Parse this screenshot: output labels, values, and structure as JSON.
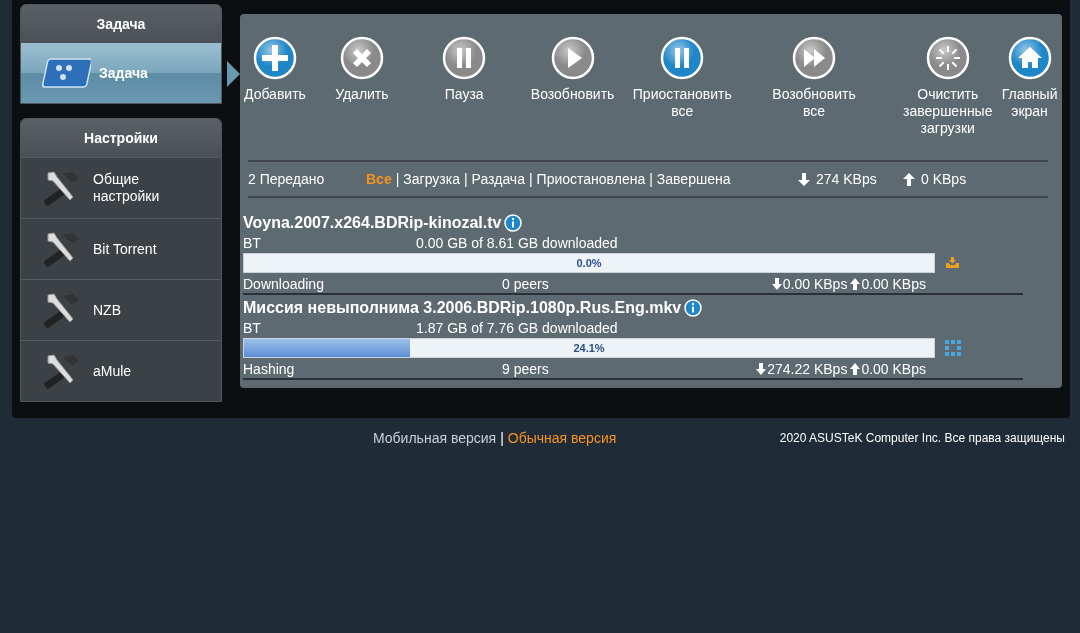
{
  "sidebar": {
    "groups": [
      {
        "title": "Задача",
        "items": [
          {
            "label": "Задача",
            "kind": "task",
            "selected": true
          }
        ]
      },
      {
        "title": "Настройки",
        "items": [
          {
            "label": "Общие настройки",
            "kind": "tools",
            "selected": false
          },
          {
            "label": "Bit Torrent",
            "kind": "tools",
            "selected": false
          },
          {
            "label": "NZB",
            "kind": "tools",
            "selected": false
          },
          {
            "label": "aMule",
            "kind": "tools",
            "selected": false
          }
        ]
      }
    ]
  },
  "toolbar": [
    {
      "label": "Добавить",
      "kind": "plus",
      "color": "#1f86c8"
    },
    {
      "label": "Удалить",
      "kind": "x",
      "color": "#8a8a8a"
    },
    {
      "label": "Пауза",
      "kind": "pause",
      "color": "#8a8a8a"
    },
    {
      "label": "Возобновить",
      "kind": "play",
      "color": "#8a8a8a"
    },
    {
      "label": "Приостановить все",
      "kind": "pause",
      "color": "#1f86c8"
    },
    {
      "label": "Возобновить все",
      "kind": "forward",
      "color": "#8a8a8a"
    },
    {
      "label": "Очистить завершенные загрузки",
      "kind": "clear",
      "color": "#8a8a8a"
    },
    {
      "label": "Главный экран",
      "kind": "home",
      "color": "#1f86c8"
    }
  ],
  "summary": {
    "count": "2 Передано",
    "separator": "|",
    "filters": [
      {
        "label": "Все",
        "selected": true
      },
      {
        "label": "Загрузка",
        "selected": false
      },
      {
        "label": "Раздача",
        "selected": false
      },
      {
        "label": "Приостановлена",
        "selected": false
      },
      {
        "label": "Завершена",
        "selected": false
      }
    ],
    "download_speed": "274 KBps",
    "upload_speed": "0 KBps"
  },
  "torrents": [
    {
      "name": "Voyna.2007.x264.BDRip-kinozal.tv",
      "type": "BT",
      "size": "0.00 GB of 8.61 GB downloaded",
      "level": 0.0,
      "percent": "0.0%",
      "status": "Downloading",
      "peers": "0 peers",
      "down": "0.00 KBps",
      "up": "0.00 KBps",
      "kind": "download"
    },
    {
      "name": "Миссия невыполнима 3.2006.BDRip.1080p.Rus.Eng.mkv",
      "type": "BT",
      "size": "1.87 GB of 7.76 GB downloaded",
      "level": 0.241,
      "percent": "24.1%",
      "status": "Hashing",
      "peers": "9 peers",
      "down": "274.22 KBps",
      "up": "0.00 KBps",
      "kind": "hashing"
    }
  ],
  "footer": {
    "separator": "|",
    "links": [
      {
        "label": "Мобильная версия",
        "selected": false
      },
      {
        "label": "Обычная версия",
        "selected": true
      }
    ],
    "copyright": "2020 ASUSTeK Computer Inc. Все права защищены"
  }
}
